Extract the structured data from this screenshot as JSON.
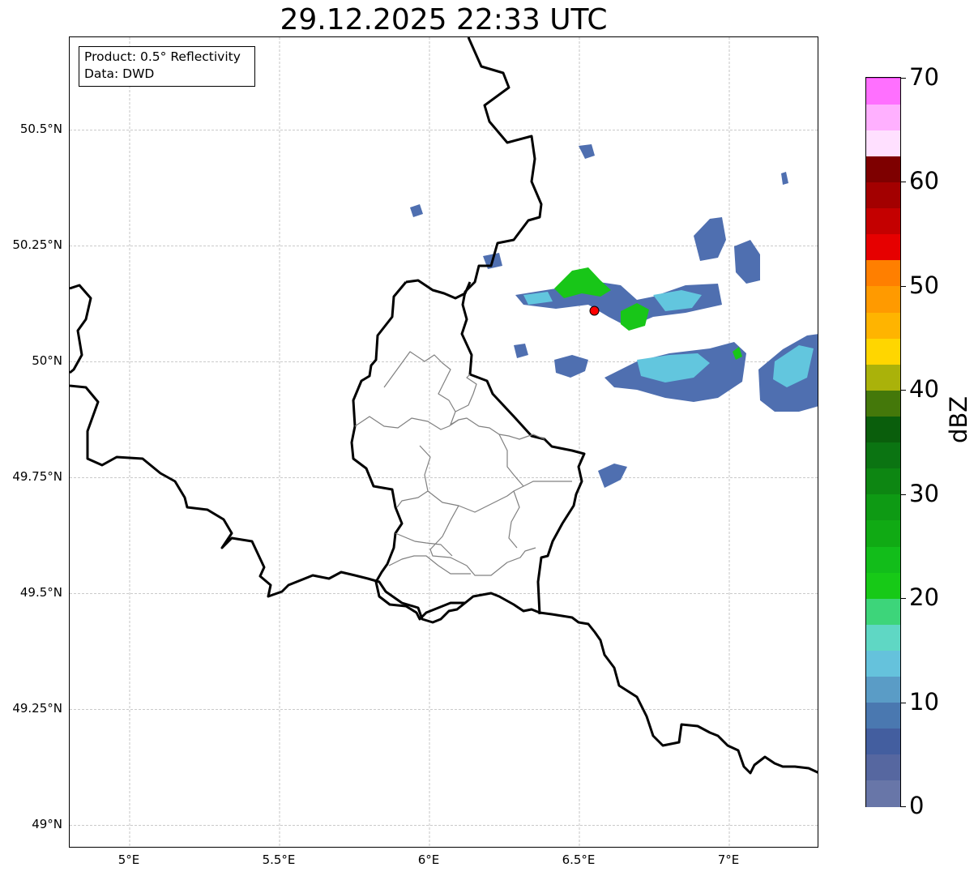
{
  "title": "29.12.2025 22:33 UTC",
  "info_box": {
    "product": "Product: 0.5° Reflectivity",
    "data": "Data: DWD"
  },
  "map": {
    "lon_range": [
      4.8,
      7.3
    ],
    "lat_range": [
      48.95,
      50.7
    ],
    "x_ticks": [
      "5°E",
      "5.5°E",
      "6°E",
      "6.5°E",
      "7°E"
    ],
    "x_tick_values": [
      5.0,
      5.5,
      6.0,
      6.5,
      7.0
    ],
    "y_ticks": [
      "50.5°N",
      "50.25°N",
      "50°N",
      "49.75°N",
      "49.5°N",
      "49.25°N",
      "49°N"
    ],
    "y_tick_values": [
      50.5,
      50.25,
      50.0,
      49.75,
      49.5,
      49.25,
      49.0
    ],
    "grid": true,
    "radar_site": {
      "lon": 6.55,
      "lat": 50.11,
      "color": "#ff0000"
    }
  },
  "colorbar": {
    "label": "dBZ",
    "ticks": [
      "0",
      "10",
      "20",
      "30",
      "40",
      "50",
      "60",
      "70"
    ],
    "tick_values": [
      0,
      10,
      20,
      30,
      40,
      50,
      60,
      70
    ],
    "range": [
      0,
      70
    ],
    "step": 2.5,
    "colors": [
      "#6876a8",
      "#5667a0",
      "#435e9f",
      "#4a78b0",
      "#5a9cc6",
      "#65c2dc",
      "#5fd7c4",
      "#3dd57a",
      "#17c917",
      "#12bd1a",
      "#10aa14",
      "#0e9a14",
      "#0d8612",
      "#0b7412",
      "#0a5e0c",
      "#44780a",
      "#aab20a",
      "#ffd600",
      "#ffb400",
      "#ff9a00",
      "#ff7f00",
      "#e60000",
      "#c40000",
      "#a30000",
      "#7e0000",
      "#ffe0ff",
      "#ffb0ff",
      "#ff70ff",
      "#e83be8"
    ]
  },
  "chart_data": {
    "type": "heatmap",
    "title": "29.12.2025 22:33 UTC",
    "colorbar_label": "dBZ",
    "value_range": [
      0,
      70
    ],
    "echo_cells": [
      {
        "lon": 6.42,
        "lat": 50.16,
        "dbz": 18
      },
      {
        "lon": 6.5,
        "lat": 50.17,
        "dbz": 22
      },
      {
        "lon": 6.62,
        "lat": 50.09,
        "dbz": 20
      },
      {
        "lon": 6.72,
        "lat": 50.11,
        "dbz": 14
      },
      {
        "lon": 6.9,
        "lat": 50.0,
        "dbz": 12
      },
      {
        "lon": 6.83,
        "lat": 50.25,
        "dbz": 10
      },
      {
        "lon": 7.19,
        "lat": 49.95,
        "dbz": 13
      },
      {
        "lon": 6.48,
        "lat": 49.99,
        "dbz": 10
      }
    ]
  }
}
